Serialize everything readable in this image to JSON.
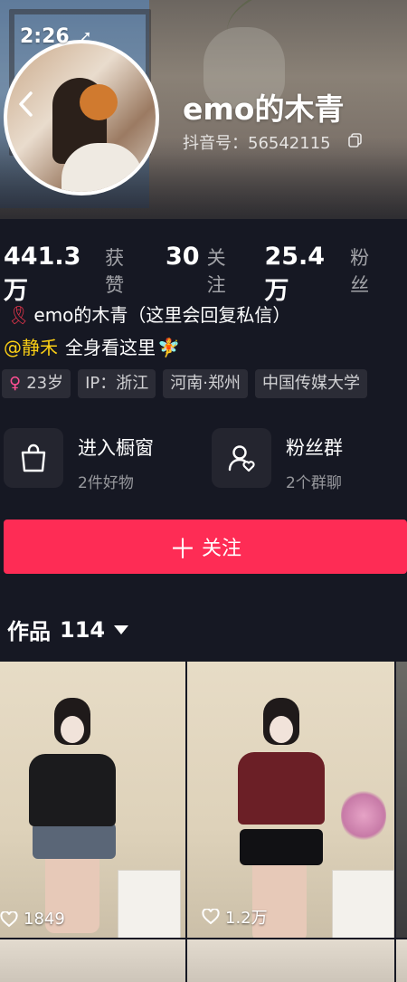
{
  "status_bar": {
    "time": "2:26",
    "location_glyph": "➚"
  },
  "profile": {
    "nickname": "emo的木青",
    "douyin_id": "抖音号：56542115",
    "stats": [
      {
        "value": "441.3万",
        "label": "获赞"
      },
      {
        "value": "30",
        "label": "关注"
      },
      {
        "value": "25.4万",
        "label": "粉丝"
      }
    ],
    "bio_line1": "emo的木青（这里会回复私信）",
    "bio_mention": "@静禾",
    "bio_line2_rest": "全身看这里",
    "tags": [
      "23岁",
      "IP：浙江",
      "河南·郑州",
      "中国传媒大学"
    ],
    "shortcuts": [
      {
        "title": "进入橱窗",
        "subtitle": "2件好物",
        "icon": "shopping-bag-icon"
      },
      {
        "title": "粉丝群",
        "subtitle": "2个群聊",
        "icon": "fan-group-icon"
      }
    ],
    "follow_label": "关注",
    "works_label": "作品",
    "works_count": "114"
  },
  "videos": [
    {
      "likes": "1849",
      "shirt_color": "#1b1b1d",
      "shorts_color": "#5a6677"
    },
    {
      "likes": "1.2万",
      "shirt_color": "#6b1f26",
      "shorts_color": "#111114"
    }
  ],
  "colors": {
    "accent": "#fe2c55",
    "mention": "#face15",
    "background": "#161823"
  }
}
